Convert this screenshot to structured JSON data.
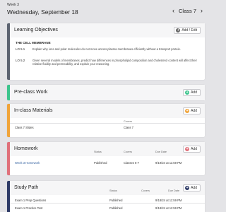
{
  "header": {
    "week": "Week 3",
    "date": "Wednesday, September 18",
    "class_label": "Class 7",
    "prev_icon": "chevron-left-icon",
    "next_icon": "chevron-right-icon"
  },
  "objectives": {
    "title": "Learning Objectives",
    "button": "Add / Edit",
    "accent": "#5c6370",
    "section": "THE CELL MEMBRANE",
    "items": [
      {
        "code": "LO 5.1",
        "text": "Explain why ions and polar molecules do not move across plasma membranes efficiently without a transport protein."
      },
      {
        "code": "LO 5.2",
        "text": "Given several models of membranes, predict how differences in phospholipid composition and cholesterol content will affect their relative fluidity and permeability, and explain your reasoning."
      }
    ]
  },
  "preclass": {
    "title": "Pre-class Work",
    "button": "Add",
    "accent": "#3cc48c",
    "icon_color": "#3cc48c"
  },
  "inclass": {
    "title": "In-class Materials",
    "button": "Add",
    "accent": "#f0a43a",
    "icon_color": "#f0a43a",
    "columns": {
      "covers": "Covers"
    },
    "rows": [
      {
        "name": "Class 7 Slides",
        "covers": "Class 7"
      }
    ]
  },
  "homework": {
    "title": "Homework",
    "button": "Add",
    "accent": "#e0707a",
    "icon_color": "#e0707a",
    "columns": {
      "status": "Status",
      "covers": "Covers",
      "due": "Due Date"
    },
    "rows": [
      {
        "name": "Week 3 Homework",
        "status": "Published",
        "covers": "Classes 6-7",
        "due": "9/19/24 at 11:59 PM"
      }
    ]
  },
  "studypath": {
    "title": "Study Path",
    "button": "Add",
    "accent": "#2d3a66",
    "icon_color": "#2d3a66",
    "columns": {
      "status": "Status",
      "covers": "Covers",
      "due": "Due Date"
    },
    "rows": [
      {
        "name": "Exam 1 Prep Questions",
        "status": "Published",
        "covers": "",
        "due": "9/18/24 at 11:59 PM"
      },
      {
        "name": "Exam 1 Practice Test",
        "status": "Published",
        "covers": "",
        "due": "9/18/24 at 11:59 PM"
      }
    ]
  }
}
